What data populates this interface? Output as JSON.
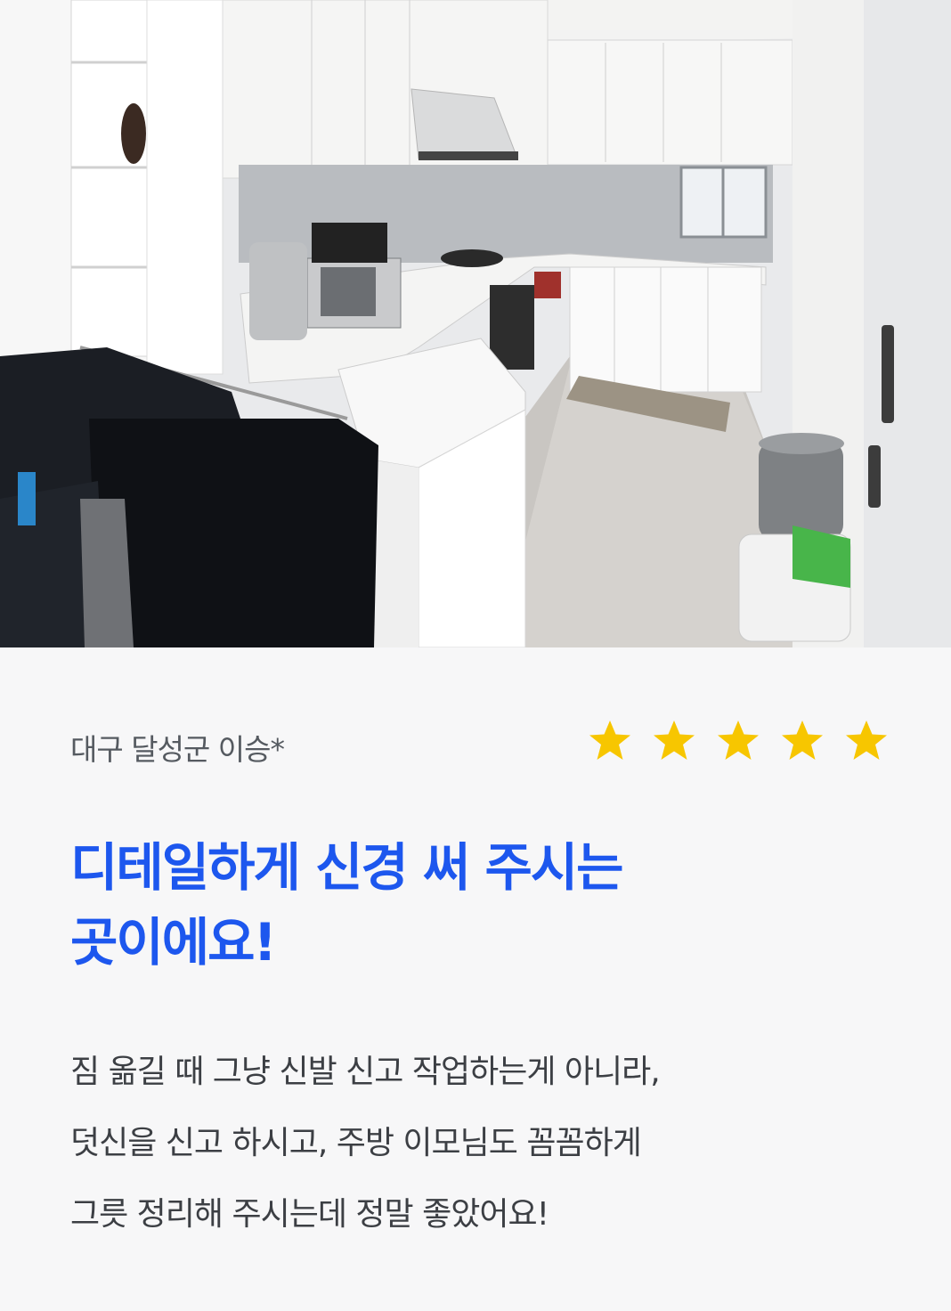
{
  "review": {
    "reviewer_name": "대구 달성군 이승*",
    "rating": 5,
    "star_color": "#f7c600",
    "headline_lines": [
      "디테일하게 신경 써 주시는",
      "곳이에요!"
    ],
    "headline_color": "#1d57ee",
    "body_lines": [
      "짐 옮길 때 그냥 신발 신고 작업하는게 아니라,",
      "덧신을 신고 하시고, 주방 이모님도 꼼꼼하게",
      "그릇 정리해 주시는데 정말 좋았어요!"
    ]
  }
}
